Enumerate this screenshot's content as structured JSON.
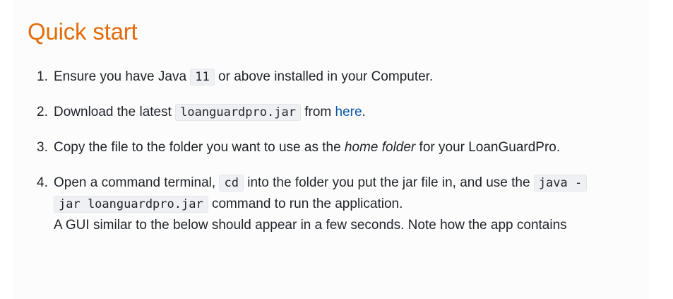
{
  "heading": "Quick start",
  "colors": {
    "heading": "#e46c0a",
    "link": "#0b57a8",
    "code_bg": "#eef0f4"
  },
  "steps": [
    {
      "number": "1.",
      "text1": "Ensure you have Java ",
      "code1": "11",
      "text2": " or above installed in your Computer."
    },
    {
      "number": "2.",
      "text1": "Download the latest ",
      "code1": "loanguardpro.jar",
      "text2": " from ",
      "link": "here",
      "text3": "."
    },
    {
      "number": "3.",
      "text1": "Copy the file to the folder you want to use as the ",
      "em": "home folder",
      "text2": " for your LoanGuardPro."
    },
    {
      "number": "4.",
      "text1": "Open a command terminal, ",
      "code1": "cd",
      "text2": " into the folder you put the jar file in, and use the ",
      "code2a": "java -",
      "code2b": "jar loanguardpro.jar",
      "text3": " command to run the application.",
      "text4": "A GUI similar to the below should appear in a few seconds. Note how the app contains"
    }
  ]
}
